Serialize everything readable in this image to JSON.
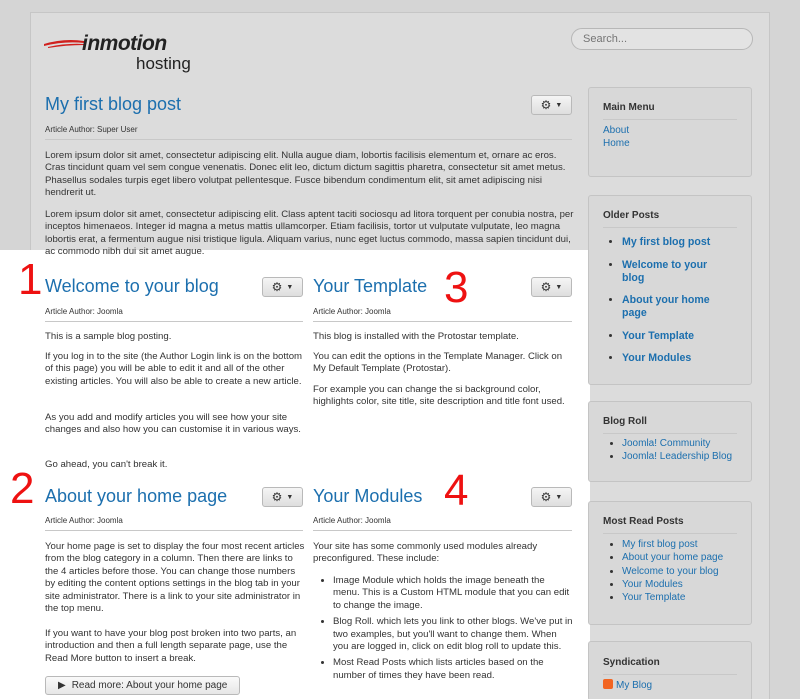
{
  "header": {
    "logo_line1": "inmotion",
    "logo_line2": "hosting",
    "search_placeholder": "Search..."
  },
  "featured": {
    "title": "My first blog post",
    "author": "Article Author: Super User",
    "p1": "Lorem ipsum dolor sit amet, consectetur adipiscing elit. Nulla augue diam, lobortis facilisis elementum et, ornare ac eros. Cras tincidunt quam vel sem congue venenatis. Donec elit leo, dictum dictum sagittis pharetra, consectetur sit amet metus. Phasellus sodales turpis eget libero volutpat pellentesque. Fusce bibendum condimentum elit, sit amet adipiscing nisi hendrerit ut.",
    "p2": "Lorem ipsum dolor sit amet, consectetur adipiscing elit. Class aptent taciti sociosqu ad litora torquent per conubia nostra, per inceptos himenaeos. Integer id magna a metus mattis ullamcorper. Etiam facilisis, tortor ut vulputate vulputate, leo magna lobortis erat, a fermentum augue nisi tristique ligula. Aliquam varius, nunc eget luctus commodo, massa sapien tincidunt dui, ac commodo nibh dui sit amet augue."
  },
  "articles": [
    {
      "number": "1",
      "title": "Welcome to your blog",
      "author": "Article Author: Joomla",
      "paras": [
        "This is a sample blog posting.",
        "If you log in to the site (the Author Login link is on the bottom of this page) you will be able to edit it and all of the other existing articles. You will also be able to create a new article.",
        "As you add and modify articles you will see how your site changes and also how you can customise it in various ways.",
        "Go ahead, you can't break it."
      ]
    },
    {
      "number": "3",
      "title": "Your Template",
      "author": "Article Author: Joomla",
      "paras": [
        "This blog is installed with the Protostar template.",
        "You can edit the options in the Template Manager. Click on My Default Template (Protostar).",
        "For example you can change the si background color, highlights color, site title, site description and title font used."
      ]
    },
    {
      "number": "2",
      "title": "About your home page",
      "author": "Article Author: Joomla",
      "paras": [
        "Your home page is set to display the four most recent articles from the blog category in a column. Then there are links to the 4 articles before those. You can change those numbers by editing the content options settings in the blog tab in your site administrator. There is a link to your site administrator in the top menu.",
        "If you want to have your blog post broken into two parts, an introduction and then a full length separate page, use the Read More button to insert a break."
      ],
      "readmore": "Read more: About your home page"
    },
    {
      "number": "4",
      "title": "Your Modules",
      "author": "Article Author: Joomla",
      "paras": [
        "Your site has some commonly used modules already preconfigured. These include:"
      ],
      "bullets": [
        "Image Module which holds the image beneath the menu. This is a Custom HTML module that you can edit to change the image.",
        "Blog Roll. which lets you link to other blogs. We've put in two examples, but you'll want to change them. When you are logged in, click on edit blog roll to update this.",
        "Most Read Posts which lists articles based on the number of times they have been read."
      ]
    }
  ],
  "sidebar": {
    "main_menu": {
      "title": "Main Menu",
      "items": [
        "About",
        "Home"
      ]
    },
    "older_posts": {
      "title": "Older Posts",
      "items": [
        "My first blog post",
        "Welcome to your blog",
        "About your home page",
        "Your Template",
        "Your Modules"
      ]
    },
    "blog_roll": {
      "title": "Blog Roll",
      "items": [
        "Joomla! Community",
        "Joomla! Leadership Blog"
      ]
    },
    "most_read": {
      "title": "Most Read Posts",
      "items": [
        "My first blog post",
        "About your home page",
        "Welcome to your blog",
        "Your Modules",
        "Your Template"
      ]
    },
    "syndication": {
      "title": "Syndication",
      "items": [
        "My Blog"
      ]
    }
  },
  "colors": {
    "link": "#1c6fae",
    "annotation": "#ee1111",
    "logo_swoosh": "#d0201e"
  }
}
